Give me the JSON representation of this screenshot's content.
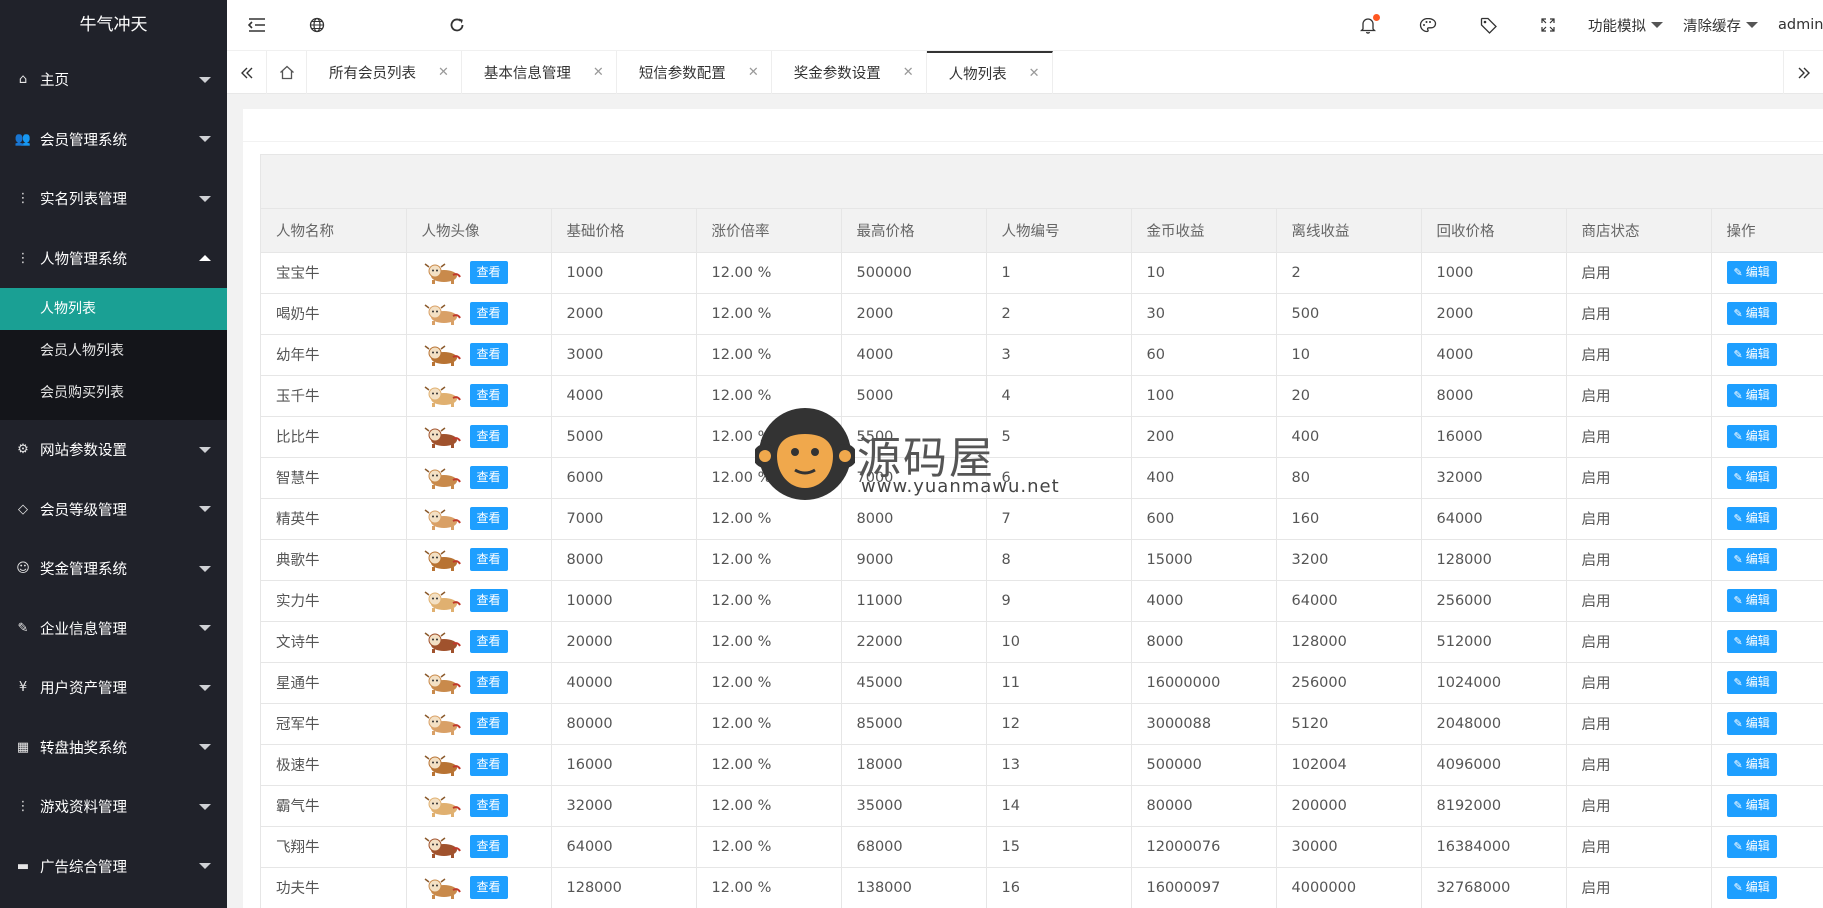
{
  "app": {
    "brand": "牛气冲天"
  },
  "sidebar": {
    "items": [
      {
        "label": "主页",
        "icon": "home-icon",
        "expanded": false
      },
      {
        "label": "会员管理系统",
        "icon": "users-icon",
        "expanded": false
      },
      {
        "label": "实名列表管理",
        "icon": "more-icon",
        "expanded": false
      },
      {
        "label": "人物管理系统",
        "icon": "more-icon",
        "expanded": true,
        "children": [
          {
            "label": "人物列表",
            "active": true
          },
          {
            "label": "会员人物列表",
            "active": false
          },
          {
            "label": "会员购买列表",
            "active": false
          }
        ]
      },
      {
        "label": "网站参数设置",
        "icon": "gear-icon",
        "expanded": false
      },
      {
        "label": "会员等级管理",
        "icon": "diamond-icon",
        "expanded": false
      },
      {
        "label": "奖金管理系统",
        "icon": "smile-icon",
        "expanded": false
      },
      {
        "label": "企业信息管理",
        "icon": "edit-icon",
        "expanded": false
      },
      {
        "label": "用户资产管理",
        "icon": "yen-icon",
        "expanded": false
      },
      {
        "label": "转盘抽奖系统",
        "icon": "app-icon",
        "expanded": false
      },
      {
        "label": "游戏资料管理",
        "icon": "more-icon",
        "expanded": false
      },
      {
        "label": "广告综合管理",
        "icon": "chat-icon",
        "expanded": false
      }
    ]
  },
  "header": {
    "menus": {
      "func_sim": "功能模拟",
      "clear_cache": "清除缓存",
      "user": "admin"
    }
  },
  "tabs": [
    {
      "label": "所有会员列表",
      "active": false
    },
    {
      "label": "基本信息管理",
      "active": false
    },
    {
      "label": "短信参数配置",
      "active": false
    },
    {
      "label": "奖金参数设置",
      "active": false
    },
    {
      "label": "人物列表",
      "active": true
    }
  ],
  "table": {
    "columns": [
      "人物名称",
      "人物头像",
      "基础价格",
      "涨价倍率",
      "最高价格",
      "人物编号",
      "金币收益",
      "离线收益",
      "回收价格",
      "商店状态",
      "操作"
    ],
    "view_label": "查看",
    "edit_label": "编辑",
    "rows": [
      [
        "宝宝牛",
        "1000",
        "12.00 %",
        "500000",
        "1",
        "10",
        "2",
        "1000",
        "启用"
      ],
      [
        "喝奶牛",
        "2000",
        "12.00 %",
        "2000",
        "2",
        "30",
        "500",
        "2000",
        "启用"
      ],
      [
        "幼年牛",
        "3000",
        "12.00 %",
        "4000",
        "3",
        "60",
        "10",
        "4000",
        "启用"
      ],
      [
        "玉千牛",
        "4000",
        "12.00 %",
        "5000",
        "4",
        "100",
        "20",
        "8000",
        "启用"
      ],
      [
        "比比牛",
        "5000",
        "12.00 %",
        "5500",
        "5",
        "200",
        "400",
        "16000",
        "启用"
      ],
      [
        "智慧牛",
        "6000",
        "12.00 %",
        "7000",
        "6",
        "400",
        "80",
        "32000",
        "启用"
      ],
      [
        "精英牛",
        "7000",
        "12.00 %",
        "8000",
        "7",
        "600",
        "160",
        "64000",
        "启用"
      ],
      [
        "典歌牛",
        "8000",
        "12.00 %",
        "9000",
        "8",
        "15000",
        "3200",
        "128000",
        "启用"
      ],
      [
        "实力牛",
        "10000",
        "12.00 %",
        "11000",
        "9",
        "4000",
        "64000",
        "256000",
        "启用"
      ],
      [
        "文诗牛",
        "20000",
        "12.00 %",
        "22000",
        "10",
        "8000",
        "128000",
        "512000",
        "启用"
      ],
      [
        "星通牛",
        "40000",
        "12.00 %",
        "45000",
        "11",
        "16000000",
        "256000",
        "1024000",
        "启用"
      ],
      [
        "冠军牛",
        "80000",
        "12.00 %",
        "85000",
        "12",
        "3000088",
        "5120",
        "2048000",
        "启用"
      ],
      [
        "极速牛",
        "16000",
        "12.00 %",
        "18000",
        "13",
        "500000",
        "102004",
        "4096000",
        "启用"
      ],
      [
        "霸气牛",
        "32000",
        "12.00 %",
        "35000",
        "14",
        "80000",
        "200000",
        "8192000",
        "启用"
      ],
      [
        "飞翔牛",
        "64000",
        "12.00 %",
        "68000",
        "15",
        "12000076",
        "30000",
        "16384000",
        "启用"
      ],
      [
        "功夫牛",
        "128000",
        "12.00 %",
        "138000",
        "16",
        "16000097",
        "4000000",
        "32768000",
        "启用"
      ]
    ]
  },
  "watermark": {
    "name": "源码屋",
    "url": "www.yuanmawu.net"
  },
  "colors": {
    "sidebar_bg": "#20222a",
    "active_green": "#1aa094",
    "button_blue": "#1e9fff",
    "notify_dot": "#ff5722"
  }
}
